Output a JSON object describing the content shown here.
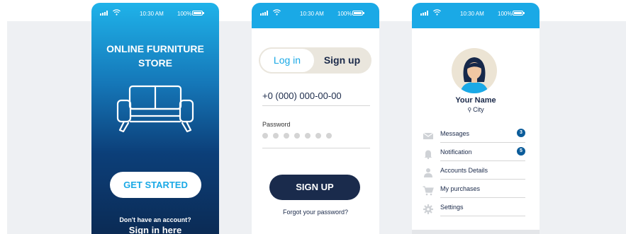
{
  "status_bar": {
    "time": "10:30 AM",
    "battery": "100%"
  },
  "welcome": {
    "title_line1": "ONLINE FURNITURE",
    "title_line2": "STORE",
    "get_started_label": "GET STARTED",
    "no_account_text": "Don't have an account?",
    "sign_in_link": "Sign in here",
    "icons": [
      "sofa-icon"
    ]
  },
  "signup": {
    "tabs": [
      {
        "label": "Log in",
        "active": false
      },
      {
        "label": "Sign up",
        "active": true
      }
    ],
    "phone_value": "+0 (000) 000-00-00",
    "password_label": "Password",
    "password_dots": 7,
    "sign_up_button": "SIGN UP",
    "forgot_link": "Forgot your password?"
  },
  "profile": {
    "name": "Your Name",
    "city": "City",
    "menu": [
      {
        "label": "Messages",
        "icon": "envelope-icon",
        "badge": "3"
      },
      {
        "label": "Notification",
        "icon": "bell-icon",
        "badge": "5"
      },
      {
        "label": "Accounts Details",
        "icon": "user-icon",
        "badge": ""
      },
      {
        "label": "My purchases",
        "icon": "cart-icon",
        "badge": ""
      },
      {
        "label": "Settings",
        "icon": "gear-icon",
        "badge": ""
      }
    ]
  },
  "colors": {
    "accent": "#1aa9e6",
    "navy": "#1a2b4c",
    "badge": "#0b5c9a",
    "background_band": "#eef0f3"
  }
}
